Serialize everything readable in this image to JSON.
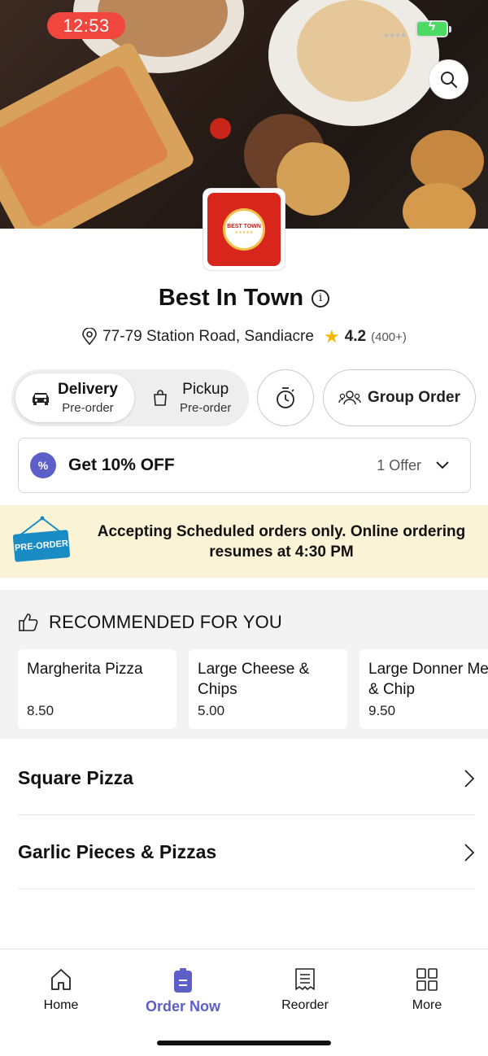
{
  "status_bar": {
    "time": "12:53"
  },
  "restaurant": {
    "name": "Best In Town",
    "address": "77-79 Station Road, Sandiacre",
    "rating": "4.2",
    "rating_count": "(400+)",
    "logo_text": "BEST TOWN"
  },
  "order_mode": {
    "delivery": {
      "label": "Delivery",
      "sub": "Pre-order",
      "selected": true
    },
    "pickup": {
      "label": "Pickup",
      "sub": "Pre-order",
      "selected": false
    },
    "group_order_label": "Group Order"
  },
  "offer": {
    "title": "Get 10% OFF",
    "count": "1 Offer",
    "badge_symbol": "%"
  },
  "banner": {
    "sign_text": "PRE-ORDER",
    "message": "Accepting Scheduled orders only. Online ordering resumes at 4:30 PM"
  },
  "recommended": {
    "title": "RECOMMENDED FOR YOU",
    "items": [
      {
        "name": "Margherita Pizza",
        "price": "8.50"
      },
      {
        "name": "Large Cheese & Chips",
        "price": "5.00"
      },
      {
        "name": "Large Donner Meat & Chip",
        "price": "9.50"
      }
    ]
  },
  "categories": [
    {
      "name": "Square Pizza"
    },
    {
      "name": "Garlic Pieces & Pizzas"
    }
  ],
  "bottom_nav": {
    "items": [
      {
        "label": "Home",
        "icon": "home-icon"
      },
      {
        "label": "Order Now",
        "icon": "order-icon",
        "active": true
      },
      {
        "label": "Reorder",
        "icon": "receipt-icon"
      },
      {
        "label": "More",
        "icon": "grid-icon"
      }
    ]
  },
  "colors": {
    "accent": "#5b5fc7",
    "banner_bg": "#fbf3d6",
    "time_pill": "#f0463e",
    "brand_red": "#d8261c"
  }
}
